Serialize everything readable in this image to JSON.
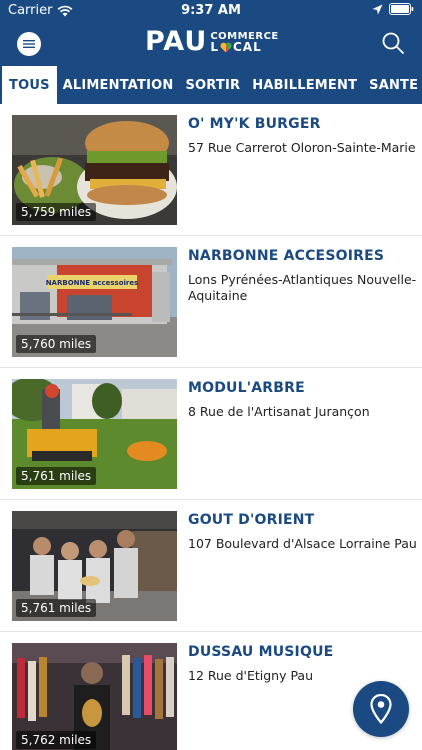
{
  "status_bar": {
    "carrier": "Carrier",
    "time": "9:37 AM"
  },
  "header": {
    "logo_main": "PAU",
    "logo_line1": "COMMERCE",
    "logo_line2_a": "L",
    "logo_line2_b": "CAL"
  },
  "tabs": [
    {
      "label": "TOUS",
      "active": true
    },
    {
      "label": "ALIMENTATION"
    },
    {
      "label": "SORTIR"
    },
    {
      "label": "HABILLEMENT"
    },
    {
      "label": "SANTE ET BIEN"
    }
  ],
  "listings": [
    {
      "name": "O' MY'K BURGER",
      "address": "57 Rue Carrerot Oloron-Sainte-Marie",
      "distance": "5,759 miles"
    },
    {
      "name": "NARBONNE ACCESOIRES",
      "address": "Lons Pyrénées-Atlantiques Nouvelle-Aquitaine",
      "distance": "5,760 miles",
      "sign_text": "NARBONNE accessoires"
    },
    {
      "name": "MODUL'ARBRE",
      "address": "8 Rue de l'Artisanat Jurançon",
      "distance": "5,761 miles"
    },
    {
      "name": "GOUT D'ORIENT",
      "address": "107 Boulevard d'Alsace Lorraine Pau",
      "distance": "5,761 miles"
    },
    {
      "name": "DUSSAU MUSIQUE",
      "address": "12 Rue d'Etigny Pau",
      "distance": "5,762 miles"
    }
  ],
  "colors": {
    "brand": "#1b4a82",
    "text": "#222222"
  }
}
